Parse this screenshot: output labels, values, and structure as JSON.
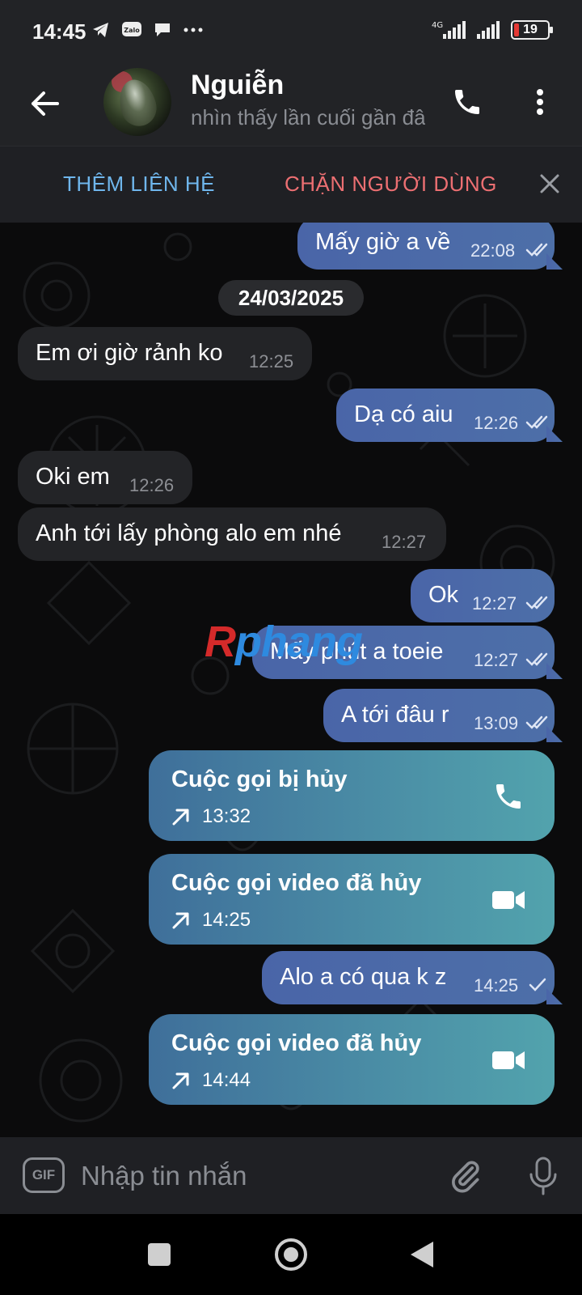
{
  "status_bar": {
    "time": "14:45",
    "left_icons": [
      "telegram-icon",
      "zalo-icon",
      "chat-icon",
      "more-dots-icon"
    ],
    "network": "4G",
    "battery": "19"
  },
  "header": {
    "contact_name": "Nguiễn",
    "contact_status": "nhìn thấy lần cuối gần đây"
  },
  "action_bar": {
    "add_contact": "THÊM LIÊN HỆ",
    "block_user": "CHẶN NGƯỜI DÙNG"
  },
  "chat": {
    "date_chip": "24/03/2025",
    "messages": [
      {
        "dir": "out",
        "text": "Mấy giờ a về",
        "time": "22:08",
        "status": "read"
      },
      {
        "dir": "in",
        "text": "Em ơi giờ rảnh ko",
        "time": "12:25"
      },
      {
        "dir": "out",
        "text": "Dạ có aiu",
        "time": "12:26",
        "status": "read"
      },
      {
        "dir": "in",
        "text": "Oki em",
        "time": "12:26"
      },
      {
        "dir": "in",
        "text": "Anh tới lấy phòng alo em nhé",
        "time": "12:27"
      },
      {
        "dir": "out",
        "text": "Ok",
        "time": "12:27",
        "status": "read"
      },
      {
        "dir": "out",
        "text": "Mấy phút a toeie",
        "time": "12:27",
        "status": "read"
      },
      {
        "dir": "out",
        "text": "A tới đâu r",
        "time": "13:09",
        "status": "read"
      },
      {
        "dir": "out",
        "type": "call",
        "text": "Cuộc gọi bị hủy",
        "time": "13:32",
        "icon": "phone-icon"
      },
      {
        "dir": "out",
        "type": "call",
        "text": "Cuộc gọi video đã hủy",
        "time": "14:25",
        "icon": "video-camera-icon"
      },
      {
        "dir": "out",
        "text": "Alo a có qua k z",
        "time": "14:25",
        "status": "sent"
      },
      {
        "dir": "out",
        "type": "call",
        "text": "Cuộc gọi video đã hủy",
        "time": "14:44",
        "icon": "video-camera-icon"
      }
    ]
  },
  "watermark": {
    "part1": "R",
    "part2": "phang"
  },
  "input": {
    "gif_label": "GIF",
    "placeholder": "Nhập tin nhắn"
  },
  "colors": {
    "bar_bg": "#222326",
    "outgoing_bubble": "#4a65a8",
    "incoming_bubble": "#232427",
    "call_bubble_start": "#3f6f9a",
    "call_bubble_end": "#52a3ad",
    "add_contact": "#6fb6ec",
    "block_user": "#ec6f72"
  }
}
